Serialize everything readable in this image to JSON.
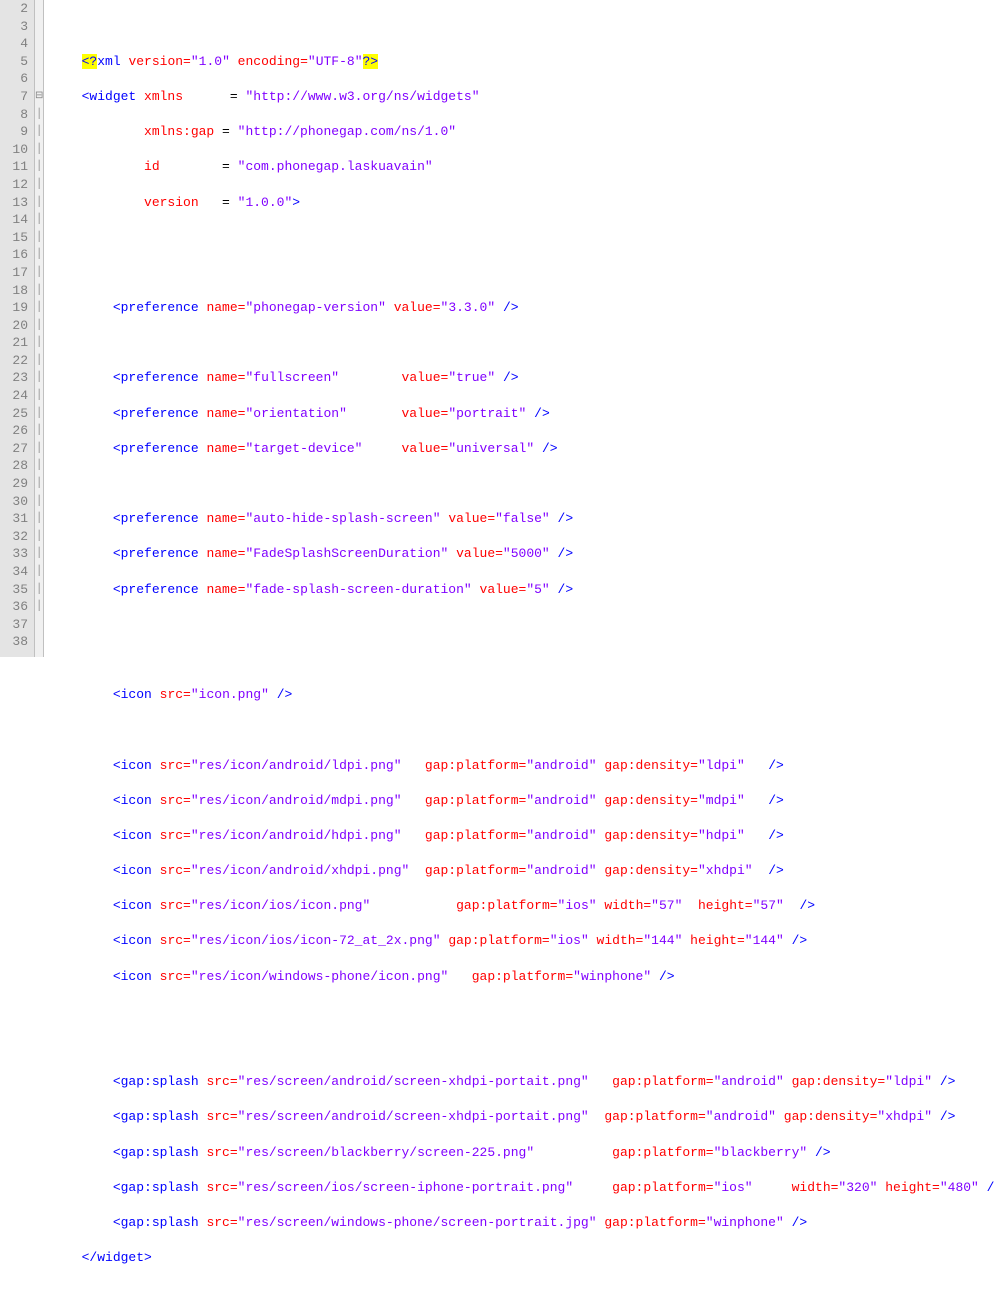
{
  "gutter_start": 2,
  "gutter_end": 38,
  "fold_line": 7,
  "lines": {
    "l3": {
      "pre": "<?",
      "xml": "xml ",
      "v_attr": "version=",
      "v_val": "\"1.0\" ",
      "e_attr": "encoding=",
      "e_val": "\"UTF-8\"",
      "post": "?>"
    },
    "l4": {
      "open": "<",
      "tag": "widget ",
      "a": "xmlns",
      "eq": "      = ",
      "v": "\"http://www.w3.org/ns/widgets\""
    },
    "l5": {
      "a": "xmlns:gap",
      "eq": " = ",
      "v": "\"http://phonegap.com/ns/1.0\""
    },
    "l6": {
      "a": "id",
      "eq": "        = ",
      "v": "\"com.phonegap.laskuavain\""
    },
    "l7": {
      "a": "version",
      "eq": "   = ",
      "v": "\"1.0.0\"",
      "close": ">"
    },
    "l10": {
      "open": "<",
      "tag": "preference ",
      "a": "name=",
      "v": "\"phonegap-version\" ",
      "a2": "value=",
      "v2": "\"3.3.0\" ",
      "close": "/>"
    },
    "l12": {
      "open": "<",
      "tag": "preference ",
      "a": "name=",
      "v": "\"fullscreen\"",
      "pad": "        ",
      "a2": "value=",
      "v2": "\"true\" ",
      "close": "/>"
    },
    "l13": {
      "open": "<",
      "tag": "preference ",
      "a": "name=",
      "v": "\"orientation\"",
      "pad": "       ",
      "a2": "value=",
      "v2": "\"portrait\" ",
      "close": "/>"
    },
    "l14": {
      "open": "<",
      "tag": "preference ",
      "a": "name=",
      "v": "\"target-device\"",
      "pad": "     ",
      "a2": "value=",
      "v2": "\"universal\" ",
      "close": "/>"
    },
    "l16": {
      "open": "<",
      "tag": "preference ",
      "a": "name=",
      "v": "\"auto-hide-splash-screen\" ",
      "a2": "value=",
      "v2": "\"false\" ",
      "close": "/>"
    },
    "l17": {
      "open": "<",
      "tag": "preference ",
      "a": "name=",
      "v": "\"FadeSplashScreenDuration\" ",
      "a2": "value=",
      "v2": "\"5000\" ",
      "close": "/>"
    },
    "l18": {
      "open": "<",
      "tag": "preference ",
      "a": "name=",
      "v": "\"fade-splash-screen-duration\" ",
      "a2": "value=",
      "v2": "\"5\" ",
      "close": "/>"
    },
    "l21": {
      "open": "<",
      "tag": "icon ",
      "a": "src=",
      "v": "\"icon.png\" ",
      "close": "/>"
    },
    "l23": {
      "open": "<",
      "tag": "icon ",
      "a": "src=",
      "v": "\"res/icon/android/ldpi.png\"",
      "pad": "   ",
      "a2": "gap:platform=",
      "v2": "\"android\" ",
      "a3": "gap:density=",
      "v3": "\"ldpi\"",
      "pad2": "   ",
      "close": "/>"
    },
    "l24": {
      "open": "<",
      "tag": "icon ",
      "a": "src=",
      "v": "\"res/icon/android/mdpi.png\"",
      "pad": "   ",
      "a2": "gap:platform=",
      "v2": "\"android\" ",
      "a3": "gap:density=",
      "v3": "\"mdpi\"",
      "pad2": "   ",
      "close": "/>"
    },
    "l25": {
      "open": "<",
      "tag": "icon ",
      "a": "src=",
      "v": "\"res/icon/android/hdpi.png\"",
      "pad": "   ",
      "a2": "gap:platform=",
      "v2": "\"android\" ",
      "a3": "gap:density=",
      "v3": "\"hdpi\"",
      "pad2": "   ",
      "close": "/>"
    },
    "l26": {
      "open": "<",
      "tag": "icon ",
      "a": "src=",
      "v": "\"res/icon/android/xhdpi.png\"",
      "pad": "  ",
      "a2": "gap:platform=",
      "v2": "\"android\" ",
      "a3": "gap:density=",
      "v3": "\"xhdpi\"",
      "pad2": "  ",
      "close": "/>"
    },
    "l27": {
      "open": "<",
      "tag": "icon ",
      "a": "src=",
      "v": "\"res/icon/ios/icon.png\"",
      "pad": "           ",
      "a2": "gap:platform=",
      "v2": "\"ios\" ",
      "a3": "width=",
      "v3": "\"57\"",
      "pad2": "  ",
      "a4": "height=",
      "v4": "\"57\"",
      "pad3": "  ",
      "close": "/>"
    },
    "l28": {
      "open": "<",
      "tag": "icon ",
      "a": "src=",
      "v": "\"res/icon/ios/icon-72_at_2x.png\" ",
      "a2": "gap:platform=",
      "v2": "\"ios\" ",
      "a3": "width=",
      "v3": "\"144\" ",
      "a4": "height=",
      "v4": "\"144\" ",
      "close": "/>"
    },
    "l29": {
      "open": "<",
      "tag": "icon ",
      "a": "src=",
      "v": "\"res/icon/windows-phone/icon.png\"",
      "pad": "   ",
      "a2": "gap:platform=",
      "v2": "\"winphone\" ",
      "close": "/>"
    },
    "l32": {
      "open": "<",
      "tag": "gap:splash ",
      "a": "src=",
      "v": "\"res/screen/android/screen-xhdpi-portait.png\"",
      "pad": "   ",
      "a2": "gap:platform=",
      "v2": "\"android\" ",
      "a3": "gap:density=",
      "v3": "\"ldpi\" ",
      "close": "/>"
    },
    "l33": {
      "open": "<",
      "tag": "gap:splash ",
      "a": "src=",
      "v": "\"res/screen/android/screen-xhdpi-portait.png\"",
      "pad": "  ",
      "a2": "gap:platform=",
      "v2": "\"android\" ",
      "a3": "gap:density=",
      "v3": "\"xhdpi\" ",
      "close": "/>"
    },
    "l34": {
      "open": "<",
      "tag": "gap:splash ",
      "a": "src=",
      "v": "\"res/screen/blackberry/screen-225.png\"",
      "pad": "          ",
      "a2": "gap:platform=",
      "v2": "\"blackberry\" ",
      "close": "/>"
    },
    "l35": {
      "open": "<",
      "tag": "gap:splash ",
      "a": "src=",
      "v": "\"res/screen/ios/screen-iphone-portrait.png\"",
      "pad": "     ",
      "a2": "gap:platform=",
      "v2": "\"ios\"",
      "pad2": "     ",
      "a3": "width=",
      "v3": "\"320\" ",
      "a4": "height=",
      "v4": "\"480\" ",
      "close": "/>"
    },
    "l36": {
      "open": "<",
      "tag": "gap:splash ",
      "a": "src=",
      "v": "\"res/screen/windows-phone/screen-portrait.jpg\" ",
      "a2": "gap:platform=",
      "v2": "\"winphone\" ",
      "close": "/>"
    },
    "l37": {
      "open": "</",
      "tag": "widget",
      "close": ">"
    }
  }
}
